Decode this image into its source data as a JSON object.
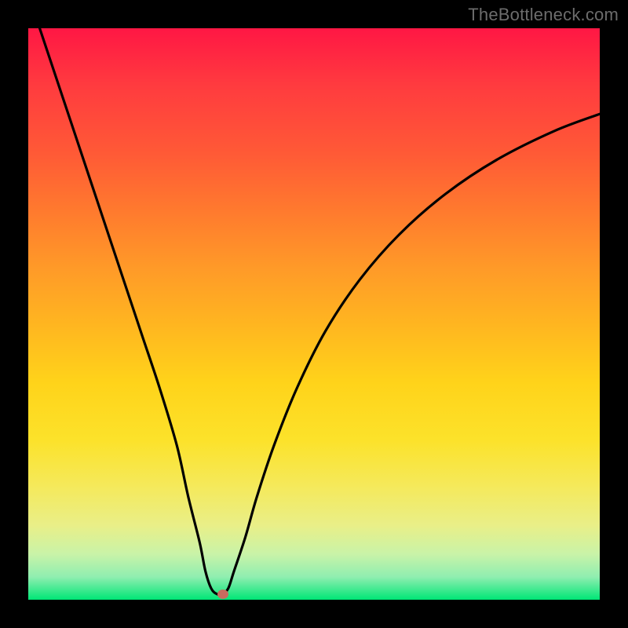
{
  "watermark": "TheBottleneck.com",
  "colors": {
    "curve": "#000000",
    "marker": "#c96a5f",
    "frame": "#000000"
  },
  "chart_data": {
    "type": "line",
    "title": "",
    "xlabel": "",
    "ylabel": "",
    "xlim": [
      0,
      100
    ],
    "ylim": [
      0,
      100
    ],
    "grid": false,
    "series": [
      {
        "name": "bottleneck-curve",
        "x": [
          2,
          5,
          8,
          11,
          14,
          17,
          20,
          23,
          26,
          28,
          30,
          31,
          32,
          33,
          34,
          35,
          36,
          38,
          40,
          43,
          47,
          52,
          58,
          65,
          73,
          82,
          92,
          100
        ],
        "y": [
          100,
          91,
          82,
          73,
          64,
          55,
          46,
          37,
          27,
          18,
          10,
          5,
          2,
          1,
          1,
          2,
          5,
          11,
          18,
          27,
          37,
          47,
          56,
          64,
          71,
          77,
          82,
          85
        ]
      }
    ],
    "annotations": [
      {
        "name": "min-marker",
        "x": 34,
        "y": 1
      }
    ]
  }
}
